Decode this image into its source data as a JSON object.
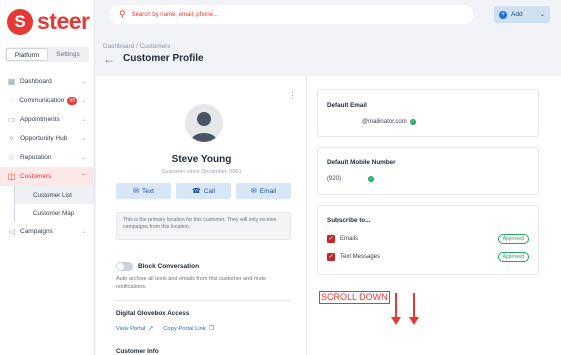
{
  "brand": {
    "name": "steer",
    "mark": "S",
    "color": "#e53935"
  },
  "sidebar": {
    "segments": [
      {
        "label": "Platform",
        "active": true
      },
      {
        "label": "Settings",
        "active": false
      }
    ],
    "items": [
      {
        "label": "Dashboard",
        "icon": "dashboard-icon"
      },
      {
        "label": "Communication",
        "icon": "chat-icon",
        "badge": "99"
      },
      {
        "label": "Appointments",
        "icon": "calendar-icon"
      },
      {
        "label": "Opportunity Hub",
        "icon": "lightbulb-icon"
      },
      {
        "label": "Reputation",
        "icon": "star-icon"
      },
      {
        "label": "Customers",
        "icon": "users-icon",
        "active": true
      },
      {
        "label": "Customer List",
        "sub": true,
        "active": true
      },
      {
        "label": "Customer Map",
        "sub": true
      },
      {
        "label": "Campaigns",
        "icon": "megaphone-icon"
      }
    ]
  },
  "topbar": {
    "search_placeholder": "Search by name, email, phone...",
    "add_label": "Add"
  },
  "page": {
    "breadcrumb": "Dashboard / Customers",
    "title": "Customer Profile"
  },
  "profile": {
    "name": "Steve Young",
    "since": "Customer since December, 0001",
    "actions": [
      {
        "label": "Text",
        "icon": "message-icon"
      },
      {
        "label": "Call",
        "icon": "phone-icon"
      },
      {
        "label": "Email",
        "icon": "mail-icon"
      }
    ],
    "notice": "This is the primary location for this customer. They will only receive campaigns from this location.",
    "block_label": "Block Conversation",
    "block_desc": "Auto archive all texts and emails from this customer and mute notifications.",
    "glovebox_title": "Digital Glovebox Access",
    "view_portal": "View Portal",
    "copy_portal": "Copy Portal Link",
    "info_title": "Customer Info"
  },
  "details": {
    "email_title": "Default Email",
    "email_value": "@mailinator.com",
    "phone_title": "Default Mobile Number",
    "phone_value": "(920)",
    "subscribe_title": "Subscribe to...",
    "subscriptions": [
      {
        "label": "Emails",
        "status": "Approved"
      },
      {
        "label": "Text Messages",
        "status": "Approved"
      }
    ]
  },
  "annotation": {
    "text": "SCROLL DOWN"
  }
}
